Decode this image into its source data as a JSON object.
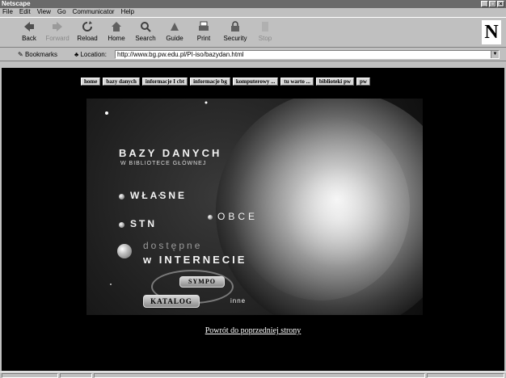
{
  "window": {
    "title": "Netscape"
  },
  "menu": [
    "File",
    "Edit",
    "View",
    "Go",
    "Communicator",
    "Help"
  ],
  "toolbar": {
    "buttons": [
      {
        "label": "Back",
        "icon": "back-arrow-icon",
        "enabled": true
      },
      {
        "label": "Forward",
        "icon": "forward-arrow-icon",
        "enabled": false
      },
      {
        "label": "Reload",
        "icon": "reload-icon",
        "enabled": true
      },
      {
        "label": "Home",
        "icon": "home-icon",
        "enabled": true
      },
      {
        "label": "Search",
        "icon": "search-icon",
        "enabled": true
      },
      {
        "label": "Guide",
        "icon": "guide-icon",
        "enabled": true
      },
      {
        "label": "Print",
        "icon": "print-icon",
        "enabled": true
      },
      {
        "label": "Security",
        "icon": "security-lock-icon",
        "enabled": true
      },
      {
        "label": "Stop",
        "icon": "stop-icon",
        "enabled": false
      }
    ]
  },
  "location": {
    "bookmarks_label": "Bookmarks",
    "location_label": "Location:",
    "url": "http://www.bg.pw.edu.pl/PI-iso/bazydan.html"
  },
  "page": {
    "nav": [
      "home",
      "bazy danych",
      "informacje I cbt",
      "informacje bg",
      "komputerowy ...",
      "tu warto ...",
      "biblioteki pw",
      "pw"
    ],
    "banner": {
      "title": "BAZY DANYCH",
      "subtitle": "W BIBLIOTECE GŁÓWNEJ",
      "wlasne": "WŁASNE",
      "obce": "OBCE",
      "stn": "STN",
      "dostepne": "dostępne",
      "w_internecie": "w INTERNECIE",
      "sympo": "SYMPO",
      "katalog": "KATALOG",
      "inne": "inne"
    },
    "back_link": "Powrót do poprzedniej strony"
  },
  "colors": {
    "chrome": "#c0c0c0",
    "page_bg": "#000000",
    "titlebar": "#6a6a6a"
  }
}
